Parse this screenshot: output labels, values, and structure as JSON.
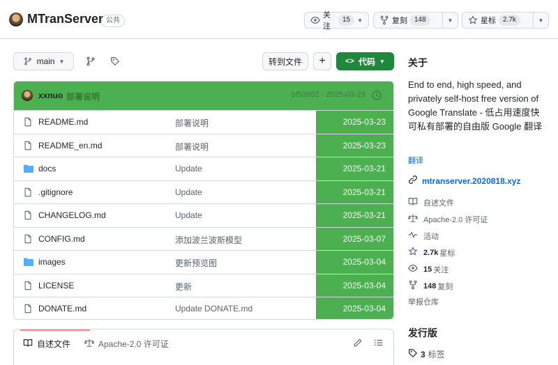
{
  "header": {
    "repo_name": "MTranServer",
    "visibility": "公共",
    "watch": {
      "label": "关注",
      "count": "15"
    },
    "fork": {
      "label": "复刻",
      "count": "148"
    },
    "star": {
      "label": "星标",
      "count": "2.7k"
    }
  },
  "branch_bar": {
    "branch": "main",
    "goto_file": "转到文件",
    "add": "+",
    "code": "代码"
  },
  "latest_commit": {
    "author": "xxnuo",
    "message": "部署说明",
    "hash_date": "bf53952 · 2025-03-23"
  },
  "files": [
    {
      "name": "README.md",
      "type": "file",
      "message": "部署说明",
      "date": "2025-03-23"
    },
    {
      "name": "README_en.md",
      "type": "file",
      "message": "部署说明",
      "date": "2025-03-23"
    },
    {
      "name": "docs",
      "type": "folder",
      "message": "Update",
      "date": "2025-03-21"
    },
    {
      "name": ".gitignore",
      "type": "file",
      "message": "Update",
      "date": "2025-03-21"
    },
    {
      "name": "CHANGELOG.md",
      "type": "file",
      "message": "Update",
      "date": "2025-03-21"
    },
    {
      "name": "CONFIG.md",
      "type": "file",
      "message": "添加波兰波斯模型",
      "date": "2025-03-07"
    },
    {
      "name": "images",
      "type": "folder",
      "message": "更新预览图",
      "date": "2025-03-04"
    },
    {
      "name": "LICENSE",
      "type": "file",
      "message": "更新",
      "date": "2025-03-04"
    },
    {
      "name": "DONATE.md",
      "type": "file",
      "message": "Update DONATE.md",
      "date": "2025-03-04"
    }
  ],
  "readme_bar": {
    "readme_tab": "自述文件",
    "license_tab": "Apache-2.0 许可证"
  },
  "sidebar": {
    "about_title": "关于",
    "description": "End to end, high speed, and privately self-host free version of Google Translate - 低占用速度快可私有部署的自由版 Google 翻译",
    "translate": "翻译",
    "website": "mtranserver.2020818.xyz",
    "readme": "自述文件",
    "license": "Apache-2.0 许可证",
    "activity": "活动",
    "stars_count": "2.7k",
    "stars_label": "星标",
    "watchers_count": "15",
    "watchers_label": "关注",
    "forks_count": "148",
    "forks_label": "复刻",
    "report": "举报仓库",
    "releases_title": "发行版",
    "tags_count": "3",
    "tags_label": "标签"
  },
  "colors": {
    "highlight_green": "#4caf50",
    "code_button": "#1f883d",
    "link_blue": "#0969da"
  }
}
